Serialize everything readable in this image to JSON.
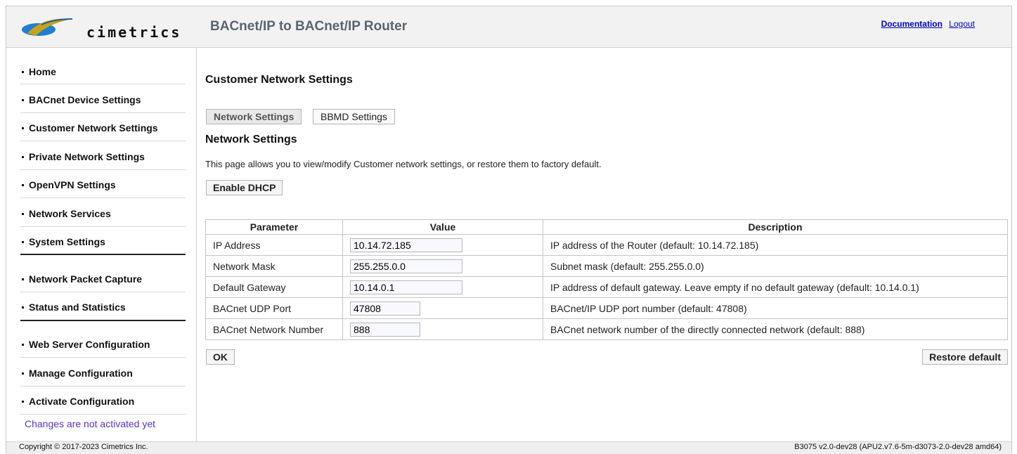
{
  "header": {
    "logo_text": "cimetrics",
    "app_title": "BACnet/IP to BACnet/IP Router",
    "links": {
      "documentation": "Documentation",
      "logout": "Logout"
    }
  },
  "sidebar": {
    "items": [
      {
        "label": "Home"
      },
      {
        "label": "BACnet Device Settings"
      },
      {
        "label": "Customer Network Settings"
      },
      {
        "label": "Private Network Settings"
      },
      {
        "label": "OpenVPN Settings"
      },
      {
        "label": "Network Services"
      },
      {
        "label": "System Settings"
      },
      {
        "label": "Network Packet Capture"
      },
      {
        "label": "Status and Statistics"
      },
      {
        "label": "Web Server Configuration"
      },
      {
        "label": "Manage Configuration"
      },
      {
        "label": "Activate Configuration"
      }
    ],
    "notice": "Changes are not activated yet"
  },
  "main": {
    "page_title": "Customer Network Settings",
    "tabs": [
      {
        "label": "Network Settings",
        "active": true
      },
      {
        "label": "BBMD Settings",
        "active": false
      }
    ],
    "section_title": "Network Settings",
    "description": "This page allows you to view/modify Customer network settings, or restore them to factory default.",
    "enable_dhcp_label": "Enable DHCP",
    "table": {
      "headers": [
        "Parameter",
        "Value",
        "Description"
      ],
      "rows": [
        {
          "param": "IP Address",
          "value": "10.14.72.185",
          "desc": "IP address of the Router (default: 10.14.72.185)"
        },
        {
          "param": "Network Mask",
          "value": "255.255.0.0",
          "desc": "Subnet mask (default: 255.255.0.0)"
        },
        {
          "param": "Default Gateway",
          "value": "10.14.0.1",
          "desc": "IP address of default gateway. Leave empty if no default gateway (default: 10.14.0.1)"
        },
        {
          "param": "BACnet UDP Port",
          "value": "47808",
          "desc": "BACnet/IP UDP port number (default: 47808)"
        },
        {
          "param": "BACnet Network Number",
          "value": "888",
          "desc": "BACnet network number of the directly connected network (default: 888)"
        }
      ]
    },
    "ok_label": "OK",
    "restore_label": "Restore default"
  },
  "footer": {
    "copyright": "Copyright © 2017-2023 Cimetrics Inc.",
    "version": "B3075 v2.0-dev28 (APU2.v7.6-5m-d3073-2.0-dev28 amd64)"
  },
  "colors": {
    "header_bg": "#f2f2f2",
    "link": "#0000cc",
    "notice": "#5533cc",
    "logo_blue": "#1f7fd0",
    "logo_gold": "#c8a21a"
  }
}
